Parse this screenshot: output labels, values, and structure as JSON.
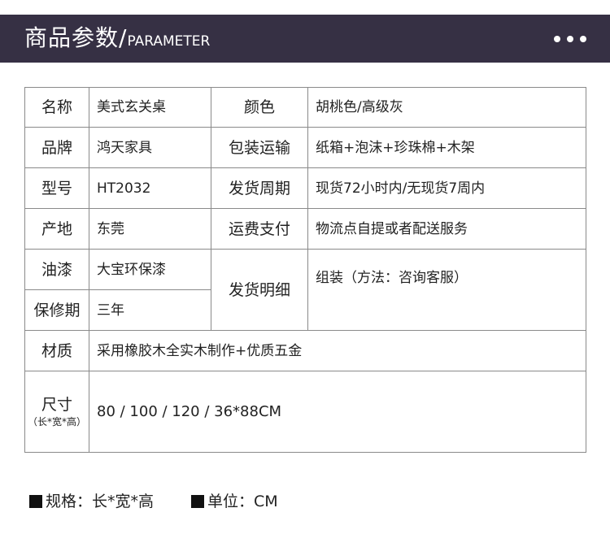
{
  "header": {
    "title": "商品参数/",
    "subtitle": "PARAMETER",
    "menu_icon": "three-dots-icon"
  },
  "params": {
    "name_label": "名称",
    "name_value": "美式玄关桌",
    "color_label": "颜色",
    "color_value": "胡桃色/高级灰",
    "brand_label": "品牌",
    "brand_value": "鸿天家具",
    "packing_label": "包装运输",
    "packing_value": "纸箱+泡沫+珍珠棉+木架",
    "model_label": "型号",
    "model_value": "HT2032",
    "shipping_cycle_label": "发货周期",
    "shipping_cycle_value": "现货72小时内/无现货7周内",
    "origin_label": "产地",
    "origin_value": "东莞",
    "freight_label": "运费支付",
    "freight_value": "物流点自提或者配送服务",
    "paint_label": "油漆",
    "paint_value": "大宝环保漆",
    "shipping_detail_label": "发货明细",
    "shipping_detail_value": "组装（方法：咨询客服）",
    "warranty_label": "保修期",
    "warranty_value": "三年",
    "material_label": "材质",
    "material_value": "采用橡胶木全实木制作+优质五金",
    "size_label": "尺寸",
    "size_sublabel": "（长*宽*高）",
    "size_value": "80 / 100 / 120 / 36*88CM"
  },
  "footer": {
    "spec_note": "规格：长*宽*高",
    "unit_note": "单位：CM"
  }
}
